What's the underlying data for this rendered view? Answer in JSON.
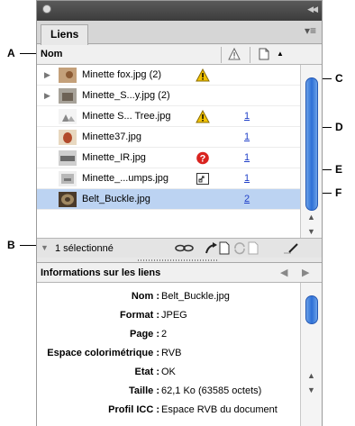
{
  "panel": {
    "tab_label": "Liens",
    "menu_icon": "panel-menu-icon"
  },
  "callouts": {
    "a": "A",
    "b": "B",
    "c": "C",
    "d": "D",
    "e": "E",
    "f": "F"
  },
  "columns": {
    "name_header": "Nom"
  },
  "links": [
    {
      "name": "Minette fox.jpg (2)",
      "status": "warning",
      "page": "",
      "expandable": true,
      "selected": false
    },
    {
      "name": "Minette_S...y.jpg (2)",
      "status": "",
      "page": "",
      "expandable": true,
      "selected": false
    },
    {
      "name": "Minette S... Tree.jpg",
      "status": "warning",
      "page": "1",
      "expandable": false,
      "selected": false
    },
    {
      "name": "Minette37.jpg",
      "status": "",
      "page": "1",
      "expandable": false,
      "selected": false
    },
    {
      "name": "Minette_IR.jpg",
      "status": "missing",
      "page": "1",
      "expandable": false,
      "selected": false
    },
    {
      "name": "Minette_...umps.jpg",
      "status": "embedded",
      "page": "1",
      "expandable": false,
      "selected": false
    },
    {
      "name": "Belt_Buckle.jpg",
      "status": "",
      "page": "2",
      "expandable": false,
      "selected": true
    }
  ],
  "status_bar": {
    "selection_count": "1 sélectionné"
  },
  "info": {
    "title": "Informations sur les liens",
    "rows": [
      {
        "label": "Nom :",
        "value": "Belt_Buckle.jpg"
      },
      {
        "label": "Format :",
        "value": "JPEG"
      },
      {
        "label": "Page :",
        "value": "2"
      },
      {
        "label": "Espace colorimétrique :",
        "value": "RVB"
      },
      {
        "label": "Etat :",
        "value": "OK"
      },
      {
        "label": "Taille :",
        "value": "62,1 Ko (63585 octets)"
      },
      {
        "label": "Profil ICC :",
        "value": "Espace RVB du document"
      }
    ]
  },
  "colors": {
    "selection": "#bcd3f2",
    "scroll_thumb": "#2d6fd6",
    "page_link": "#1f3fc8",
    "warning": "#f2c200",
    "missing": "#d9231f"
  }
}
